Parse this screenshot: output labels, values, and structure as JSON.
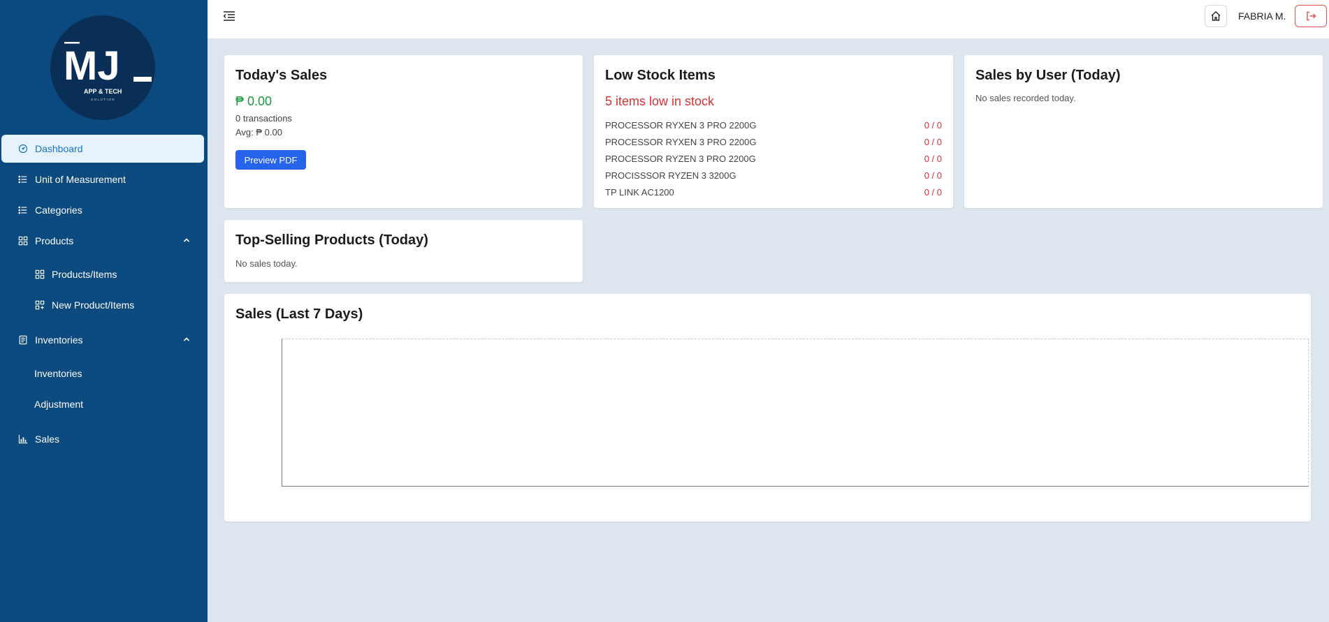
{
  "brand": {
    "logo_text": "MJ",
    "logo_sub": "APP & TECH",
    "logo_sub2": "SOLUTION"
  },
  "sidebar": {
    "items": [
      {
        "label": "Dashboard",
        "icon": "gauge-icon"
      },
      {
        "label": "Unit of Measurement",
        "icon": "list-icon"
      },
      {
        "label": "Categories",
        "icon": "list-icon"
      },
      {
        "label": "Products",
        "icon": "grid-icon"
      },
      {
        "label": "Products/Items",
        "icon": "grid-icon"
      },
      {
        "label": "New Product/Items",
        "icon": "grid-plus-icon"
      },
      {
        "label": "Inventories",
        "icon": "clipboard-icon"
      },
      {
        "label": "Inventories",
        "icon": ""
      },
      {
        "label": "Adjustment",
        "icon": ""
      },
      {
        "label": "Sales",
        "icon": "bar-chart-icon"
      }
    ]
  },
  "topbar": {
    "user_name": "FABRIA M."
  },
  "todays_sales": {
    "title": "Today's Sales",
    "amount": "₱ 0.00",
    "transactions": "0 transactions",
    "avg": "Avg: ₱ 0.00",
    "button": "Preview PDF"
  },
  "low_stock": {
    "title": "Low Stock Items",
    "count_text": "5 items low in stock",
    "items": [
      {
        "name": "PROCESSOR RYXEN 3 PRO 2200G",
        "value": "0 / 0"
      },
      {
        "name": "PROCESSOR RYXEN 3 PRO 2200G",
        "value": "0 / 0"
      },
      {
        "name": "PROCESSOR RYZEN 3 PRO 2200G",
        "value": "0 / 0"
      },
      {
        "name": "PROCISSSOR RYZEN 3 3200G",
        "value": "0 / 0"
      },
      {
        "name": "TP LINK AC1200",
        "value": "0 / 0"
      }
    ]
  },
  "sales_by_user": {
    "title": "Sales by User (Today)",
    "empty": "No sales recorded today."
  },
  "top_selling": {
    "title": "Top-Selling Products (Today)",
    "empty": "No sales today."
  },
  "sales_chart": {
    "title": "Sales (Last 7 Days)"
  },
  "colors": {
    "sidebar": "#0b4a7f",
    "accent": "#1876c9",
    "success": "#1a9a3a",
    "danger": "#d83232",
    "button": "#2563eb"
  }
}
